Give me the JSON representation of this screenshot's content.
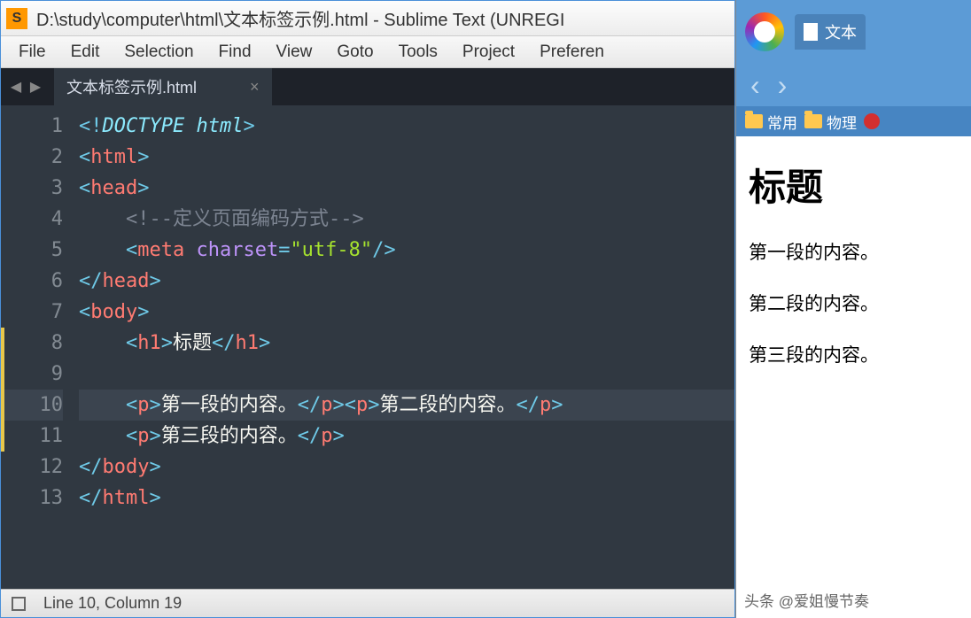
{
  "title": "D:\\study\\computer\\html\\文本标签示例.html - Sublime Text (UNREGI",
  "menubar": [
    "File",
    "Edit",
    "Selection",
    "Find",
    "View",
    "Goto",
    "Tools",
    "Project",
    "Preferen"
  ],
  "tab": {
    "name": "文本标签示例.html"
  },
  "activeLine": 10,
  "markedLines": [
    8,
    9,
    10,
    11
  ],
  "statusbar": {
    "text": "Line 10, Column 19"
  },
  "browser": {
    "tabTitle": "文本",
    "bookmarks": [
      "常用",
      "物理"
    ],
    "page": {
      "heading": "标题",
      "paragraphs": [
        "第一段的内容。",
        "第二段的内容。",
        "第三段的内容。"
      ]
    }
  },
  "attribution": "头条 @爱姐慢节奏",
  "code": [
    [
      [
        "bracket",
        "<!"
      ],
      [
        "doc",
        "DOCTYPE html"
      ],
      [
        "bracket",
        ">"
      ]
    ],
    [
      [
        "bracket",
        "<"
      ],
      [
        "tag",
        "html"
      ],
      [
        "bracket",
        ">"
      ]
    ],
    [
      [
        "bracket",
        "<"
      ],
      [
        "tag",
        "head"
      ],
      [
        "bracket",
        ">"
      ]
    ],
    [
      [
        "indent",
        "    "
      ],
      [
        "cmt",
        "<!--定义页面编码方式-->"
      ]
    ],
    [
      [
        "indent",
        "    "
      ],
      [
        "bracket",
        "<"
      ],
      [
        "tag",
        "meta"
      ],
      [
        "text",
        " "
      ],
      [
        "attr",
        "charset"
      ],
      [
        "op",
        "="
      ],
      [
        "str",
        "\"utf-8\""
      ],
      [
        "bracket",
        "/>"
      ]
    ],
    [
      [
        "bracket",
        "</"
      ],
      [
        "tag",
        "head"
      ],
      [
        "bracket",
        ">"
      ]
    ],
    [
      [
        "bracket",
        "<"
      ],
      [
        "tag",
        "body"
      ],
      [
        "bracket",
        ">"
      ]
    ],
    [
      [
        "indent",
        "    "
      ],
      [
        "bracket",
        "<"
      ],
      [
        "tag",
        "h1"
      ],
      [
        "bracket",
        ">"
      ],
      [
        "text",
        "标题"
      ],
      [
        "bracket",
        "</"
      ],
      [
        "tag",
        "h1"
      ],
      [
        "bracket",
        ">"
      ]
    ],
    [],
    [
      [
        "indent",
        "    "
      ],
      [
        "bracket",
        "<"
      ],
      [
        "tag",
        "p"
      ],
      [
        "bracket",
        ">"
      ],
      [
        "text",
        "第一段的内容。"
      ],
      [
        "bracket",
        "</"
      ],
      [
        "tag",
        "p"
      ],
      [
        "bracket",
        ">"
      ],
      [
        "bracket",
        "<"
      ],
      [
        "tag",
        "p"
      ],
      [
        "bracket",
        ">"
      ],
      [
        "text",
        "第二段的内容。"
      ],
      [
        "bracket",
        "</"
      ],
      [
        "tag",
        "p"
      ],
      [
        "bracket",
        ">"
      ]
    ],
    [
      [
        "indent",
        "    "
      ],
      [
        "bracket",
        "<"
      ],
      [
        "tag",
        "p"
      ],
      [
        "bracket",
        ">"
      ],
      [
        "text",
        "第三段的内容。"
      ],
      [
        "bracket",
        "</"
      ],
      [
        "tag",
        "p"
      ],
      [
        "bracket",
        ">"
      ]
    ],
    [
      [
        "bracket",
        "</"
      ],
      [
        "tag",
        "body"
      ],
      [
        "bracket",
        ">"
      ]
    ],
    [
      [
        "bracket",
        "</"
      ],
      [
        "tag",
        "html"
      ],
      [
        "bracket",
        ">"
      ]
    ]
  ]
}
